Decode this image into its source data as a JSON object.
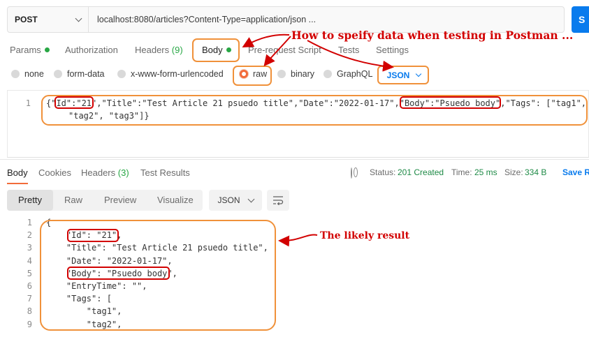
{
  "request": {
    "method": "POST",
    "url": "localhost:8080/articles?Content-Type=application/json ...",
    "send_label": "S"
  },
  "request_tabs": [
    {
      "label": "Params"
    },
    {
      "label": "Authorization"
    },
    {
      "label": "Headers",
      "count": "(9)"
    },
    {
      "label": "Body"
    },
    {
      "label": "Pre-request Script"
    },
    {
      "label": "Tests"
    },
    {
      "label": "Settings"
    }
  ],
  "body_types": {
    "none": "none",
    "form_data": "form-data",
    "urlencoded": "x-www-form-urlencoded",
    "raw": "raw",
    "binary": "binary",
    "graphql": "GraphQL",
    "selected": "raw"
  },
  "raw_format": "JSON",
  "request_body": {
    "line_number": "1",
    "lines": [
      "{\"Id\":\"21\",\"Title\":\"Test Article 21 psuedo title\",\"Date\":\"2022-01-17\",\"Body\":\"Psuedo body\",\"Tags\": [\"tag1\",",
      "\"tag2\", \"tag3\"]}"
    ]
  },
  "response_tabs": {
    "body": "Body",
    "cookies": "Cookies",
    "headers": "Headers",
    "headers_count": "(3)",
    "test_results": "Test Results"
  },
  "response_status": {
    "status_label": "Status:",
    "status_value": "201 Created",
    "time_label": "Time:",
    "time_value": "25 ms",
    "size_label": "Size:",
    "size_value": "334 B",
    "save_label": "Save R"
  },
  "response_views": {
    "pretty": "Pretty",
    "raw": "Raw",
    "preview": "Preview",
    "visualize": "Visualize",
    "format": "JSON"
  },
  "response_body": [
    {
      "n": "1",
      "text": "{"
    },
    {
      "n": "2",
      "text": "    \"Id\": \"21\","
    },
    {
      "n": "3",
      "text": "    \"Title\": \"Test Article 21 psuedo title\","
    },
    {
      "n": "4",
      "text": "    \"Date\": \"2022-01-17\","
    },
    {
      "n": "5",
      "text": "    \"Body\": \"Psuedo body\","
    },
    {
      "n": "6",
      "text": "    \"EntryTime\": \"\","
    },
    {
      "n": "7",
      "text": "    \"Tags\": ["
    },
    {
      "n": "8",
      "text": "        \"tag1\","
    },
    {
      "n": "9",
      "text": "        \"tag2\","
    }
  ],
  "annotations": {
    "heading": "How to speify data when testing in Postman ...",
    "result_note": "The likely result",
    "color": "#d20000",
    "highlight_color": "#f0913a"
  },
  "colors": {
    "accent": "#f26b3a",
    "send": "#097bed",
    "status_ok": "#1e8a46",
    "tab_dot": "#28a745"
  }
}
